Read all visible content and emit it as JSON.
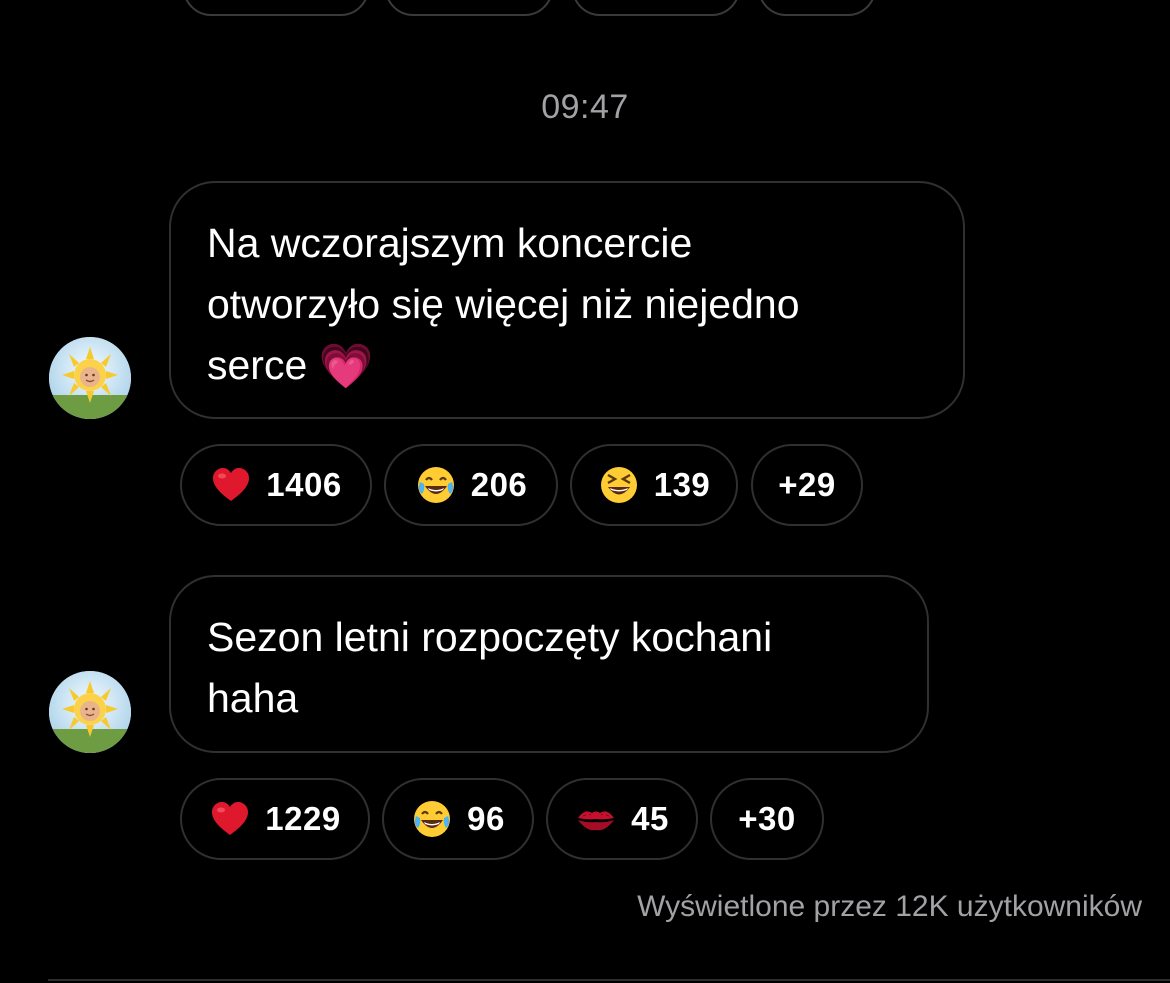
{
  "timestamp": "09:47",
  "messages": [
    {
      "text": "Na wczorajszym koncercie\notworzyło się więcej niż niejedno\nserce",
      "emoji": "💗",
      "avatar_icon": "sun-baby-avatar",
      "reactions": [
        {
          "emoji": "❤️",
          "icon": "red-heart-icon",
          "count": "1406"
        },
        {
          "emoji": "😂",
          "icon": "tears-of-joy-icon",
          "count": "206"
        },
        {
          "emoji": "😆",
          "icon": "grinning-squinting-icon",
          "count": "139"
        },
        {
          "emoji": "",
          "icon": "",
          "count": "+29"
        }
      ]
    },
    {
      "text": "Sezon letni rozpoczęty kochani\nhaha",
      "emoji": "",
      "avatar_icon": "sun-baby-avatar",
      "reactions": [
        {
          "emoji": "❤️",
          "icon": "red-heart-icon",
          "count": "1229"
        },
        {
          "emoji": "😂",
          "icon": "tears-of-joy-icon",
          "count": "96"
        },
        {
          "emoji": "💋",
          "icon": "kiss-mark-icon",
          "count": "45"
        },
        {
          "emoji": "",
          "icon": "",
          "count": "+30"
        }
      ]
    }
  ],
  "seen_by": "Wyświetlone przez 12K użytkowników",
  "colors": {
    "background": "#000000",
    "bubble_border": "#303033",
    "muted_text": "#a1a1a6",
    "heart": "#e0182d",
    "emoji_yellow": "#ffcc33"
  }
}
